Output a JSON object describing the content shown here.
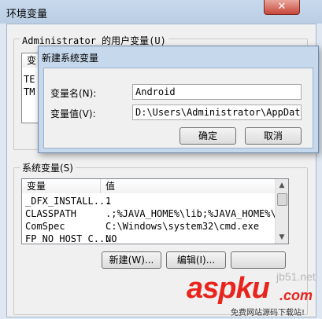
{
  "outer_window": {
    "title": "环境变量",
    "close_glyph": "✕"
  },
  "user_vars": {
    "group_label": "Administrator 的用户变量(U)",
    "col_var_partial": "变",
    "row1_partial": "TE",
    "row2_partial": "TM"
  },
  "dialog": {
    "title": "新建系统变量",
    "name_label": "变量名(N):",
    "name_value": "Android",
    "value_label": "变量值(V):",
    "value_value": "D:\\Users\\Administrator\\AppData\\Local",
    "ok": "确定",
    "cancel": "取消"
  },
  "system_vars": {
    "group_label": "系统变量(S)",
    "col_var": "变量",
    "col_value": "值",
    "rows": [
      {
        "name": "_DFX_INSTALL...",
        "value": "1"
      },
      {
        "name": "CLASSPATH",
        "value": ".;%JAVA_HOME%\\lib;%JAVA_HOME%\\l..."
      },
      {
        "name": "ComSpec",
        "value": "C:\\Windows\\system32\\cmd.exe"
      },
      {
        "name": "FP_NO_HOST_C...",
        "value": "NO"
      }
    ],
    "new_btn": "新建(W)...",
    "edit_btn": "编辑(I)..."
  },
  "watermark": {
    "main": "aspku",
    "dotcom": ".com",
    "faint": "jb51.net",
    "sub": "免费网站源码下载站!"
  },
  "colors": {
    "watermark_red": "#e8241c",
    "close_red": "#c8463a"
  }
}
